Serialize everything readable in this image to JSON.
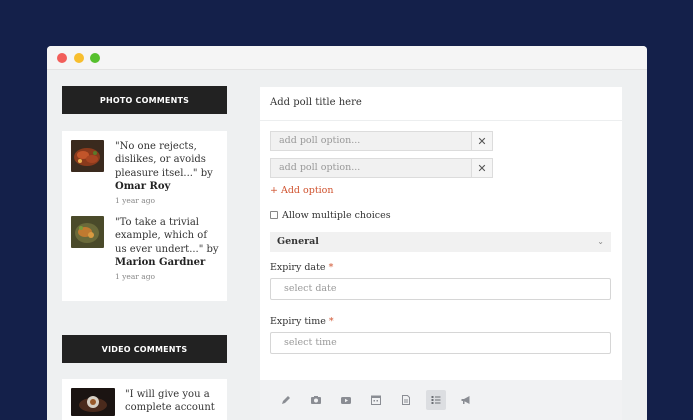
{
  "sidebar": {
    "photo_heading": "PHOTO COMMENTS",
    "photo_comments": [
      {
        "text": "\"No one rejects, dislikes, or avoids pleasure itsel...\" by",
        "author": "Omar Roy",
        "time": "1 year ago",
        "thumb": "food-photo"
      },
      {
        "text": "\"To take a trivial example, which of us ever undert...\" by",
        "author": "Marion Gardner",
        "time": "1 year ago",
        "thumb": "food-photo"
      }
    ],
    "video_heading": "VIDEO COMMENTS",
    "video_comments": [
      {
        "text": "\"I will give you a complete account",
        "thumb": "video-thumbnail"
      }
    ]
  },
  "poll": {
    "title_placeholder": "Add poll title here",
    "options": [
      {
        "placeholder": "add poll option..."
      },
      {
        "placeholder": "add poll option..."
      }
    ],
    "add_option_label": "+ Add option",
    "allow_multiple_label": "Allow multiple choices",
    "category_value": "General",
    "expiry_date_label": "Expiry date",
    "expiry_date_placeholder": "select date",
    "expiry_time_label": "Expiry time",
    "expiry_time_placeholder": "select time",
    "required_marker": "*"
  },
  "toolbar": {
    "tools": [
      "pencil-icon",
      "camera-icon",
      "video-icon",
      "calendar-icon",
      "document-icon",
      "list-icon",
      "megaphone-icon"
    ],
    "active_tool": "list-icon"
  },
  "colors": {
    "background": "#14204a",
    "accent_red": "#d0532f",
    "heading_bar": "#222222"
  }
}
